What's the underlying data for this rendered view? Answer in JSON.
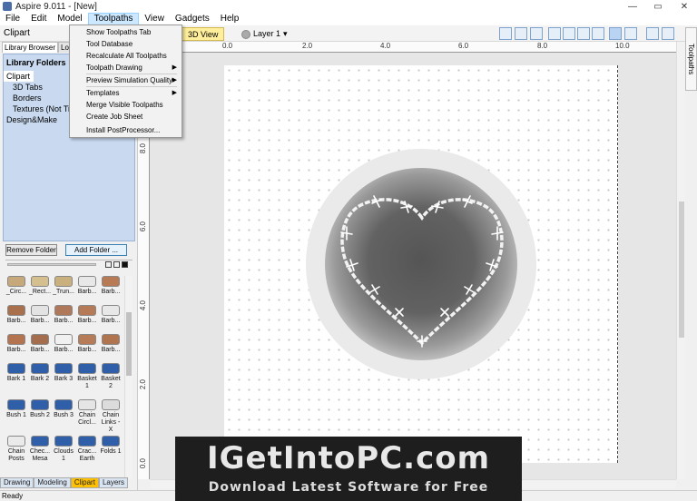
{
  "window": {
    "title": "Aspire 9.011 - [New]",
    "minimize": "—",
    "maximize": "▭",
    "close": "✕"
  },
  "menu": [
    "File",
    "Edit",
    "Model",
    "Toolpaths",
    "View",
    "Gadgets",
    "Help"
  ],
  "toolbar": {
    "panel_title": "Clipart",
    "view_tab": "3D View",
    "layer": "Layer 1"
  },
  "left_panel": {
    "tabs": [
      "Library Browser",
      "Loca"
    ],
    "library_header": "Library Folders",
    "folders": [
      {
        "label": "Clipart",
        "indent": false,
        "selected": true
      },
      {
        "label": "3D Tabs",
        "indent": true,
        "selected": false
      },
      {
        "label": "Borders",
        "indent": true,
        "selected": false
      },
      {
        "label": "Textures (Not Tila",
        "indent": true,
        "selected": false
      },
      {
        "label": "Design&Make",
        "indent": false,
        "selected": false
      }
    ],
    "remove_button": "Remove Folder",
    "add_button": "Add Folder ...",
    "clipart": [
      {
        "label": "_Circ...",
        "color": "#c7a87a"
      },
      {
        "label": "_Rect...",
        "color": "#d6bf8e"
      },
      {
        "label": "_Trun...",
        "color": "#c9b07c"
      },
      {
        "label": "Barb...",
        "color": "#e8e8e8"
      },
      {
        "label": "Barb...",
        "color": "#b87a55"
      },
      {
        "label": "Barb...",
        "color": "#a8704c"
      },
      {
        "label": "Barb...",
        "color": "#e3e3e3"
      },
      {
        "label": "Barb...",
        "color": "#b0785a"
      },
      {
        "label": "Barb...",
        "color": "#b57a58"
      },
      {
        "label": "Barb...",
        "color": "#e8e8e8"
      },
      {
        "label": "Barb...",
        "color": "#b4744f"
      },
      {
        "label": "Barb...",
        "color": "#a46d4e"
      },
      {
        "label": "Barb...",
        "color": "#f0f0f0"
      },
      {
        "label": "Barb...",
        "color": "#b67c57"
      },
      {
        "label": "Barb...",
        "color": "#b0744f"
      },
      {
        "label": "Bark 1",
        "color": "#2f5fa8"
      },
      {
        "label": "Bark 2",
        "color": "#2f5fa8"
      },
      {
        "label": "Bark 3",
        "color": "#2f5fa8"
      },
      {
        "label": "Basket 1",
        "color": "#2f5fa8"
      },
      {
        "label": "Basket 2",
        "color": "#2f5fa8"
      },
      {
        "label": "Bush 1",
        "color": "#2f5fa8"
      },
      {
        "label": "Bush 2",
        "color": "#2f5fa8"
      },
      {
        "label": "Bush 3",
        "color": "#2f5fa8"
      },
      {
        "label": "Chain Circl...",
        "color": "#e5e5e5"
      },
      {
        "label": "Chain Links - X",
        "color": "#dcdcdc"
      },
      {
        "label": "Chain Posts",
        "color": "#eaeaea"
      },
      {
        "label": "Chec... Mesa",
        "color": "#2f5fa8"
      },
      {
        "label": "Clouds 1",
        "color": "#2f5fa8"
      },
      {
        "label": "Crac... Earth",
        "color": "#2f5fa8"
      },
      {
        "label": "Folds 1",
        "color": "#2f5fa8"
      }
    ],
    "bottom_tabs": [
      {
        "label": "Drawing",
        "selected": false
      },
      {
        "label": "Modeling",
        "selected": false
      },
      {
        "label": "Clipart",
        "selected": true
      },
      {
        "label": "Layers",
        "selected": false
      }
    ]
  },
  "rulers": {
    "h": [
      {
        "label": "0.0",
        "pos": 80
      },
      {
        "label": "2.0",
        "pos": 168
      },
      {
        "label": "4.0",
        "pos": 254
      },
      {
        "label": "6.0",
        "pos": 340
      },
      {
        "label": "8.0",
        "pos": 427
      },
      {
        "label": "10.0",
        "pos": 513
      }
    ],
    "v": [
      {
        "label": "8.0",
        "pos": 100
      },
      {
        "label": "6.0",
        "pos": 186
      },
      {
        "label": "4.0",
        "pos": 273
      },
      {
        "label": "2.0",
        "pos": 360
      },
      {
        "label": "0.0",
        "pos": 447
      }
    ]
  },
  "toolpaths_menu": {
    "items": [
      {
        "label": "Show Toolpaths Tab",
        "sub": false
      },
      {
        "label": "Tool Database",
        "sub": false
      },
      {
        "label": "Recalculate All Toolpaths",
        "sub": false
      },
      {
        "label": "Toolpath Drawing",
        "sub": true
      },
      {
        "label": "Preview Simulation Quality",
        "sub": true
      },
      {
        "label": "Templates",
        "sub": true
      },
      {
        "label": "Merge Visible Toolpaths",
        "sub": false
      },
      {
        "label": "Create Job Sheet",
        "sub": false
      },
      {
        "label": "Install PostProcessor...",
        "sub": false
      }
    ]
  },
  "right_tab": "Toolpaths",
  "status": "Ready",
  "watermark": {
    "line1": "IGetIntoPC.com",
    "line2": "Download Latest Software for Free"
  }
}
